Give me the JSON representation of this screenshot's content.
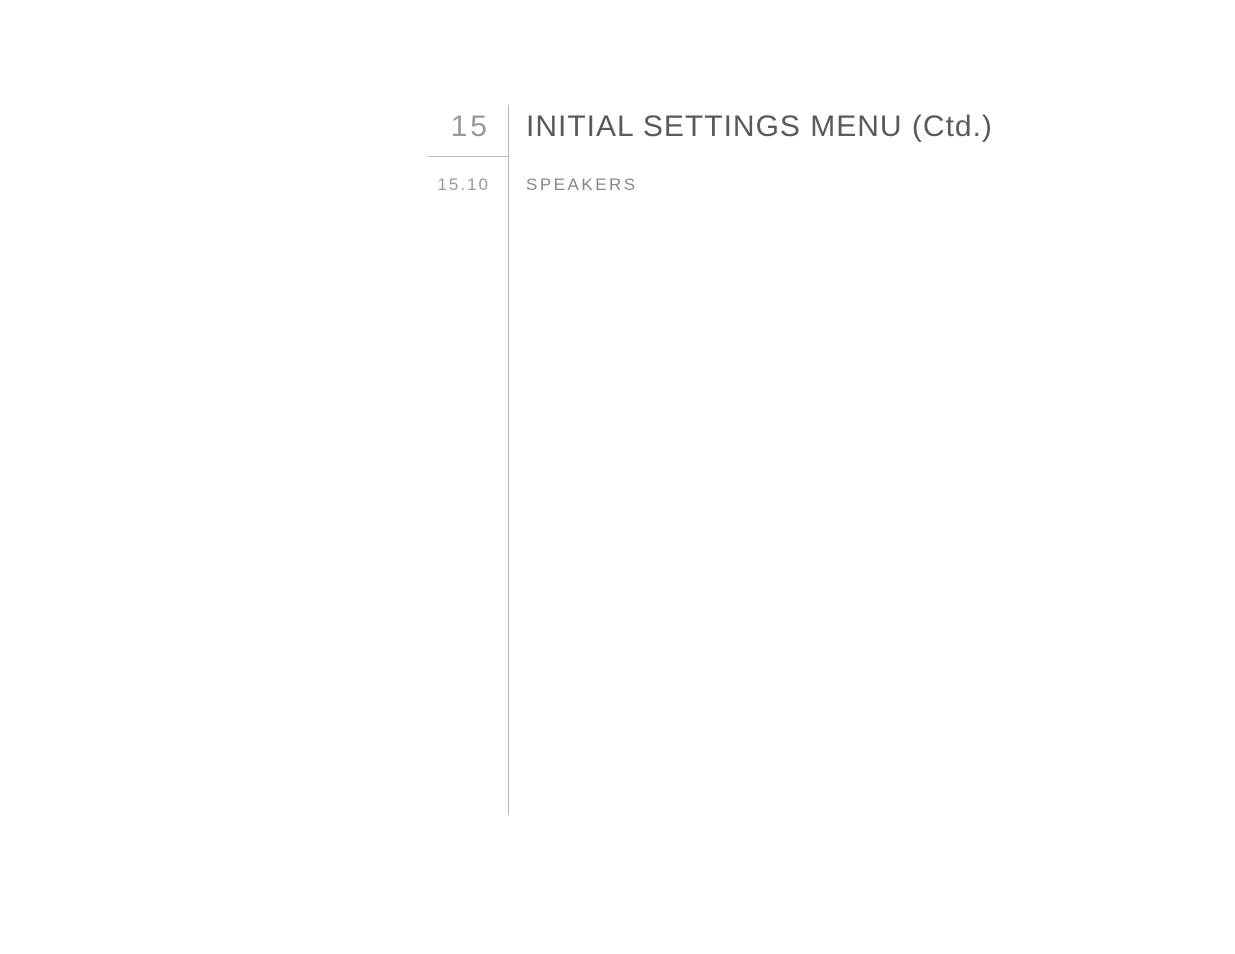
{
  "section": {
    "number": "15",
    "title": "INITIAL SETTINGS MENU (Ctd.)"
  },
  "subsection": {
    "number": "15.10",
    "title": "SPEAKERS"
  }
}
